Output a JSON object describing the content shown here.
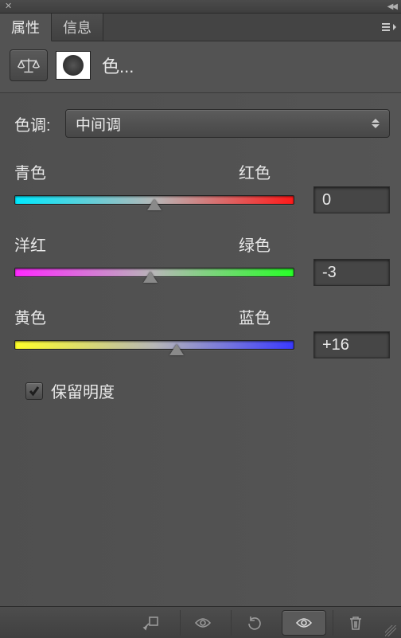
{
  "tabs": {
    "properties": "属性",
    "info": "信息"
  },
  "panel_title": "色...",
  "tone_label": "色调:",
  "tone_selected": "中间调",
  "sliders": {
    "cr": {
      "left": "青色",
      "right": "红色",
      "value": "0",
      "pos": 50
    },
    "mg": {
      "left": "洋红",
      "right": "绿色",
      "value": "-3",
      "pos": 48.5
    },
    "yb": {
      "left": "黄色",
      "right": "蓝色",
      "value": "+16",
      "pos": 58
    }
  },
  "preserve_luminosity": "保留明度"
}
